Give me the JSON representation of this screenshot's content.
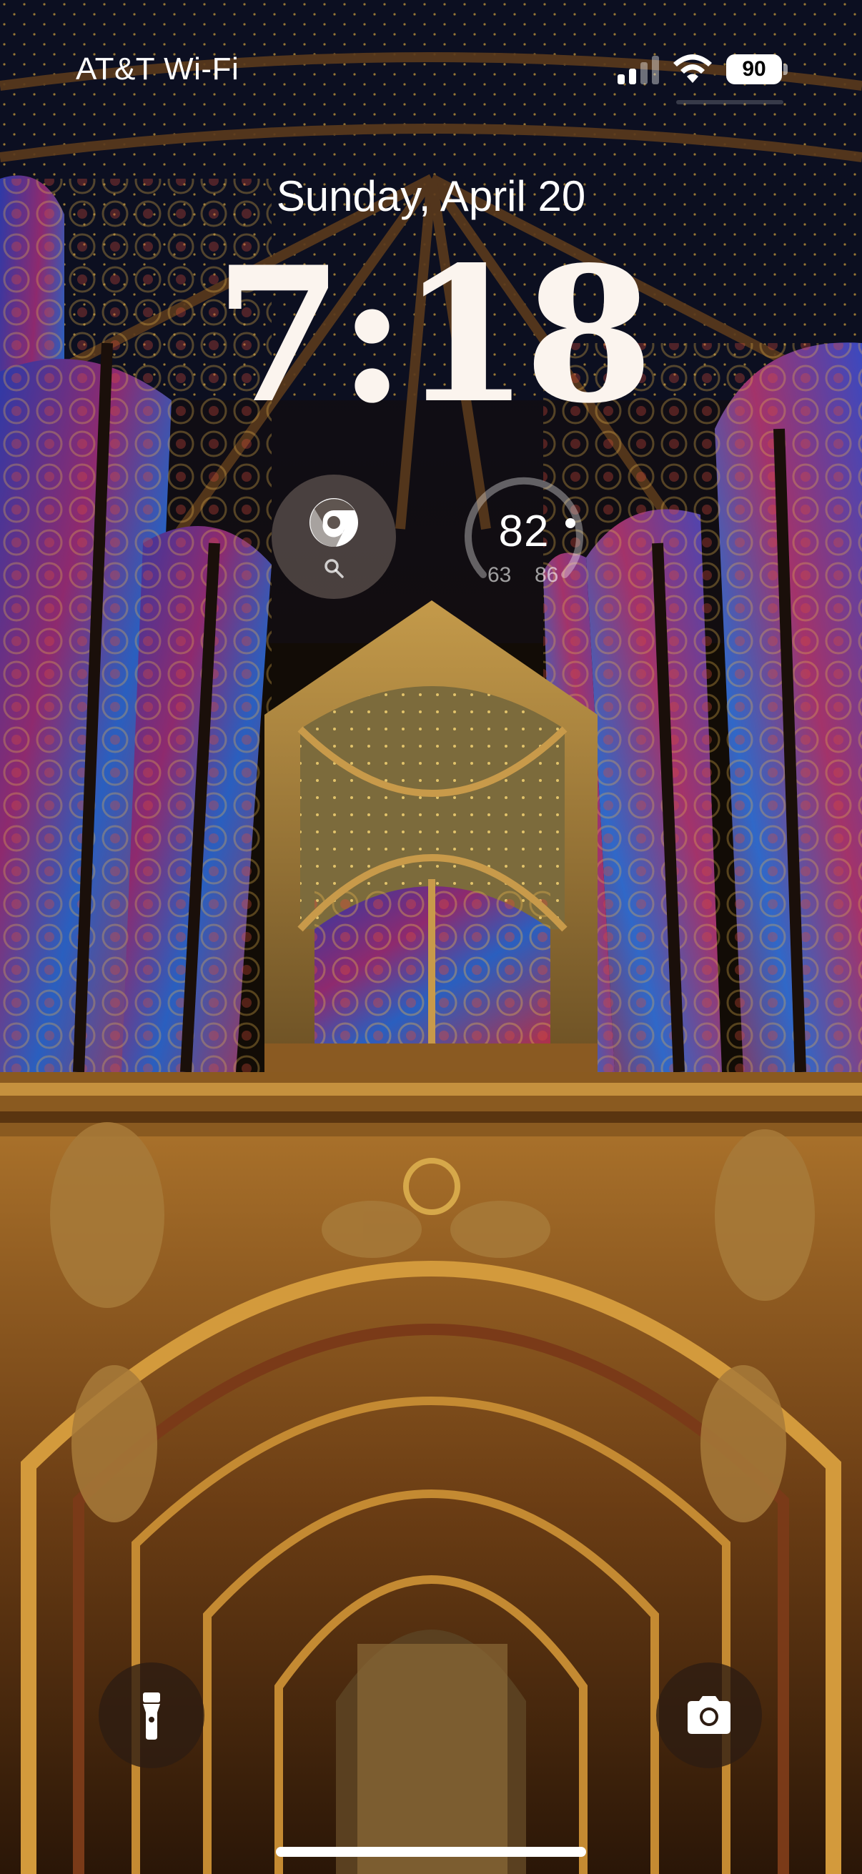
{
  "status_bar": {
    "carrier": "AT&T Wi-Fi",
    "battery_level": "90",
    "signal_icon": "cellular-signal-icon",
    "wifi_icon": "wifi-icon"
  },
  "lock_screen": {
    "date": "Sunday, April 20",
    "time": "7:18"
  },
  "widgets": {
    "chrome": {
      "icon": "chrome-icon",
      "search_icon": "search-icon"
    },
    "weather": {
      "current_temp": "82",
      "low": "63",
      "high": "86"
    }
  },
  "buttons": {
    "flashlight_icon": "flashlight-icon",
    "camera_icon": "camera-icon"
  },
  "colors": {
    "text": "#ffffff",
    "time_text": "#fbf4ee",
    "widget_bg": "#5f5550",
    "button_bg": "#2d1c12"
  }
}
